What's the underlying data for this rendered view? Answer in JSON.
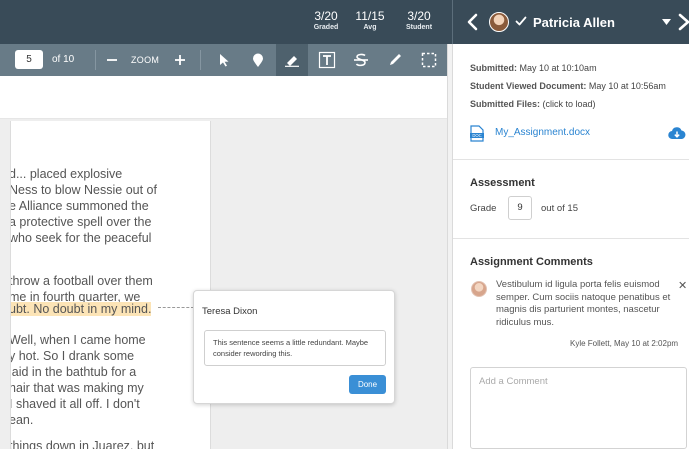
{
  "header": {
    "stats": [
      {
        "value": "3/20",
        "label": "Graded"
      },
      {
        "value": "11/15",
        "label": "Avg"
      },
      {
        "value": "3/20",
        "label": "Student"
      }
    ],
    "student_name": "Patricia Allen"
  },
  "toolbar": {
    "page_value": "5",
    "page_of": "of 10",
    "zoom_label": "ZOOM"
  },
  "document": {
    "lines": [
      "d... placed explosive",
      "Ness to blow Nessie out of",
      "e Alliance summoned the",
      "a protective spell over the",
      " who seek for the peaceful",
      "",
      "throw a football over them",
      "me in fourth quarter, we",
      "ubt. No doubt in my mind.",
      "Well, when I came home",
      "y hot. So I drank some",
      "laid in the bathtub for a",
      "hair that was making my",
      " I shaved it all off. I don't",
      "ean.",
      "",
      "things down in Juarez, but"
    ]
  },
  "comment_popup": {
    "author": "Teresa Dixon",
    "text": "This sentence seems a little redundant. Maybe consider  rewording this.",
    "done_label": "Done"
  },
  "sidebar": {
    "submitted_label": "Submitted:",
    "submitted_value": "May 10 at 10:10am",
    "viewed_label": "Student Viewed Document:",
    "viewed_value": "May 10 at 10:56am",
    "files_label": "Submitted Files:",
    "files_value": "(click to load)",
    "file_name": "My_Assignment.docx",
    "assessment_heading": "Assessment",
    "grade_label": "Grade",
    "grade_value": "9",
    "grade_of": "out of 15",
    "comments_heading": "Assignment Comments",
    "comment_text": "Vestibulum id ligula porta felis euismod semper. Cum sociis natoque penatibus et magnis dis parturient montes, nascetur ridiculus mus.",
    "comment_meta": "Kyle Follett, May 10 at 2:02pm",
    "add_comment_placeholder": "Add a Comment"
  },
  "colors": {
    "header_bg": "#394B58",
    "toolbar_bg": "#687B87",
    "link_blue": "#2A84D1",
    "done_button": "#3A8FD6",
    "highlight": "#FCE4B6"
  },
  "icons": {
    "prev": "chevron-left-icon",
    "next": "chevron-right-icon",
    "check": "check-icon",
    "dropdown": "caret-down-icon",
    "zoom_out": "minus-icon",
    "zoom_in": "plus-icon",
    "select": "pointer-icon",
    "point": "pin-icon",
    "highlight": "highlighter-icon",
    "text": "text-box-icon",
    "strike": "strikethrough-icon",
    "draw": "pencil-icon",
    "area": "area-select-icon",
    "file": "doc-file-icon",
    "download": "cloud-download-icon"
  }
}
